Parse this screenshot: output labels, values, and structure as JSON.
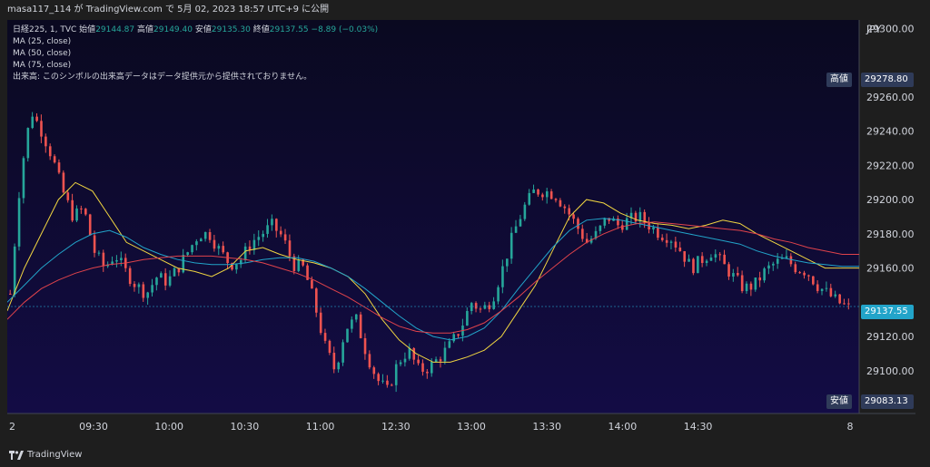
{
  "header": {
    "text": "masa117_114 が TradingView.com で 5月 02, 2023 18:57 UTC+9 に公開"
  },
  "legend": {
    "symbol": "日経225, 1, TVC",
    "open_label": "始値",
    "open": "29144.87",
    "high_label": "高値",
    "high": "29149.40",
    "low_label": "安値",
    "low": "29135.30",
    "close_label": "終値",
    "close": "29137.55",
    "change": "−8.89 (−0.03%)",
    "ma25": "MA (25, close)",
    "ma50": "MA (50, close)",
    "ma75": "MA (75, close)",
    "volume_note": "出来高: このシンボルの出来高データはデータ提供元から提供されておりません。"
  },
  "axis": {
    "currency": "JPY",
    "high_tag_label": "高値",
    "high_tag_value": "29278.80",
    "last_tag_value": "29137.55",
    "low_tag_label": "安値",
    "low_tag_value": "29083.13"
  },
  "brand": {
    "name": "TradingView"
  },
  "colors": {
    "up": "#26a69a",
    "down": "#ef5350",
    "ma25": "#f0d541",
    "ma50": "#22a4c9",
    "ma75": "#e0434b",
    "background_top": "#0a0920",
    "background_bottom": "#130c45"
  },
  "chart_data": {
    "type": "line",
    "subtype": "candlestick",
    "y_ticks": [
      "29300.00",
      "29260.00",
      "29240.00",
      "29220.00",
      "29200.00",
      "29180.00",
      "29160.00",
      "29120.00",
      "29100.00"
    ],
    "x_ticks": [
      "2",
      "09:30",
      "10:00",
      "10:30",
      "11:00",
      "12:30",
      "13:00",
      "13:30",
      "14:00",
      "14:30",
      "8"
    ],
    "ylim": [
      29075,
      29305
    ],
    "series": [
      {
        "name": "MA (25, close)",
        "values": [
          29135,
          29160,
          29180,
          29200,
          29210,
          29205,
          29190,
          29175,
          29170,
          29165,
          29160,
          29158,
          29155,
          29160,
          29170,
          29172,
          29168,
          29165,
          29163,
          29160,
          29155,
          29145,
          29130,
          29118,
          29110,
          29105,
          29105,
          29108,
          29112,
          29120,
          29135,
          29150,
          29170,
          29190,
          29200,
          29198,
          29192,
          29188,
          29186,
          29185,
          29183,
          29185,
          29188,
          29186,
          29180,
          29175,
          29170,
          29165,
          29160,
          29160,
          29160
        ]
      },
      {
        "name": "MA (50, close)",
        "values": [
          29140,
          29150,
          29160,
          29168,
          29175,
          29180,
          29182,
          29178,
          29172,
          29168,
          29165,
          29163,
          29162,
          29162,
          29163,
          29165,
          29166,
          29166,
          29164,
          29160,
          29155,
          29148,
          29140,
          29132,
          29125,
          29120,
          29118,
          29120,
          29125,
          29135,
          29148,
          29160,
          29172,
          29182,
          29188,
          29189,
          29188,
          29186,
          29184,
          29182,
          29180,
          29178,
          29176,
          29174,
          29170,
          29167,
          29165,
          29163,
          29162,
          29161,
          29161
        ]
      },
      {
        "name": "MA (75, close)",
        "values": [
          29130,
          29140,
          29148,
          29153,
          29157,
          29160,
          29162,
          29163,
          29165,
          29166,
          29167,
          29167,
          29167,
          29166,
          29165,
          29163,
          29160,
          29157,
          29153,
          29148,
          29143,
          29137,
          29131,
          29126,
          29123,
          29122,
          29122,
          29124,
          29128,
          29135,
          29143,
          29152,
          29160,
          29168,
          29175,
          29180,
          29184,
          29186,
          29187,
          29186,
          29185,
          29184,
          29183,
          29182,
          29180,
          29177,
          29175,
          29172,
          29170,
          29168,
          29168
        ]
      }
    ],
    "candles_close": [
      29137.55
    ]
  }
}
